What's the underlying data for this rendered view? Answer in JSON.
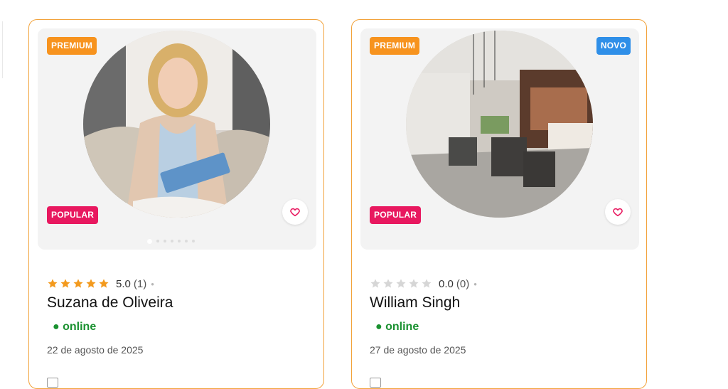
{
  "cards": [
    {
      "badge_top_left": "PREMIUM",
      "badge_top_right": "",
      "badge_bottom": "POPULAR",
      "rating_value": "5.0",
      "rating_count": "(1)",
      "rating_separator": "•",
      "stars_filled": 5,
      "name": "Suzana de Oliveira",
      "status": "● online",
      "date": "22 de agosto de 2025",
      "photo_subject": "woman-with-clipboard-photo",
      "carousel_dots": 7
    },
    {
      "badge_top_left": "PREMIUM",
      "badge_top_right": "NOVO",
      "badge_bottom": "POPULAR",
      "rating_value": "0.0",
      "rating_count": "(0)",
      "rating_separator": "•",
      "stars_filled": 0,
      "name": "William Singh",
      "status": "● online",
      "date": "27 de agosto de 2025",
      "photo_subject": "restaurant-interior-photo",
      "carousel_dots": 0
    }
  ],
  "colors": {
    "card_border": "#f2a23a",
    "premium": "#f7931e",
    "novo": "#2f8fe8",
    "popular": "#e8185f",
    "online": "#1a9130",
    "star_filled": "#f39a1e",
    "star_empty": "#d6d6d6",
    "heart": "#e8185f"
  },
  "icons": [
    "star-icon",
    "heart-icon",
    "mail-icon"
  ]
}
